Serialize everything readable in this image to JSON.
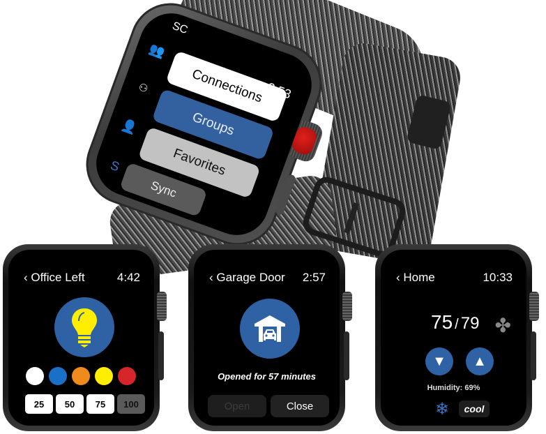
{
  "main_watch": {
    "initials": "SC",
    "time": "2:53",
    "sidebar_icons": [
      "connections-icon",
      "groups-icon",
      "favorites-icon",
      "sync-logo-icon"
    ],
    "buttons": {
      "connections": "Connections",
      "groups": "Groups",
      "favorites": "Favorites",
      "sync": "Sync"
    },
    "selected": "Groups",
    "accent_color": "#33609e"
  },
  "light_watch": {
    "title": "Office Left",
    "back_glyph": "‹",
    "time": "4:42",
    "icon": "lightbulb-icon",
    "icon_color": "#ffee00",
    "colors": [
      "#ffffff",
      "#1a6fc6",
      "#f08a1c",
      "#ffee00",
      "#d7262b"
    ],
    "levels": [
      "25",
      "50",
      "75",
      "100"
    ],
    "selected_level": "100"
  },
  "garage_watch": {
    "title": "Garage Door",
    "back_glyph": "‹",
    "time": "2:57",
    "icon": "garage-car-icon",
    "status": "Opened for 57 minutes",
    "buttons": {
      "open": "Open",
      "close": "Close"
    },
    "open_disabled": true
  },
  "thermostat_watch": {
    "title": "Home",
    "back_glyph": "‹",
    "time": "10:33",
    "current_temp": "75",
    "separator": "/",
    "set_temp": "79",
    "fan_icon": "fan-icon",
    "down_label": "▼",
    "up_label": "▲",
    "humidity": "Humidity: 69%",
    "mode_icon": "❄",
    "mode": "cool"
  }
}
